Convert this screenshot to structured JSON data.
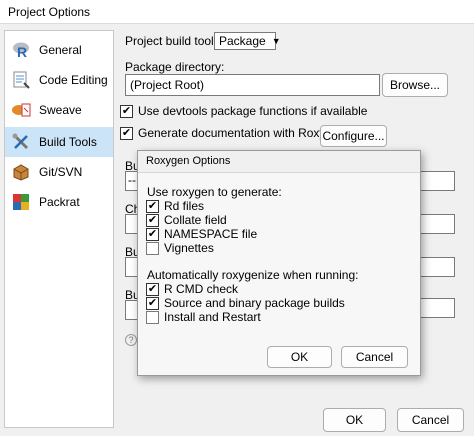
{
  "window": {
    "title": "Project Options"
  },
  "sidebar": {
    "items": [
      {
        "label": "General",
        "icon": "r-logo-icon"
      },
      {
        "label": "Code Editing",
        "icon": "code-editing-icon"
      },
      {
        "label": "Sweave",
        "icon": "sweave-icon"
      },
      {
        "label": "Build Tools",
        "icon": "build-tools-icon",
        "selected": true
      },
      {
        "label": "Git/SVN",
        "icon": "git-svn-icon"
      },
      {
        "label": "Packrat",
        "icon": "packrat-icon"
      }
    ]
  },
  "main": {
    "build_tools_label": "Project build tools:",
    "build_tools_value": "Package",
    "package_dir_label": "Package directory:",
    "package_dir_value": "(Project Root)",
    "browse_label": "Browse...",
    "devtools_label": "Use devtools package functions if available",
    "devtools_checked": true,
    "roxygen_label": "Generate documentation with Roxygen",
    "roxygen_checked": true,
    "configure_label": "Configure...",
    "partial_labels": [
      "Bu",
      "Ch",
      "Bu",
      "Bu"
    ],
    "partial_field_value": "--",
    "help_glyph": "?"
  },
  "roxygen_dialog": {
    "title": "Roxygen Options",
    "section1_label": "Use roxygen to generate:",
    "generate": [
      {
        "label": "Rd files",
        "checked": true
      },
      {
        "label": "Collate field",
        "checked": true
      },
      {
        "label": "NAMESPACE file",
        "checked": true
      },
      {
        "label": "Vignettes",
        "checked": false
      }
    ],
    "section2_label": "Automatically roxygenize when running:",
    "auto": [
      {
        "label": "R CMD check",
        "checked": true
      },
      {
        "label": "Source and binary package builds",
        "checked": true
      },
      {
        "label": "Install and Restart",
        "checked": false
      }
    ],
    "ok_label": "OK",
    "cancel_label": "Cancel"
  },
  "footer": {
    "ok_label": "OK",
    "cancel_label": "Cancel"
  },
  "colors": {
    "selected_bg": "#cce4f7",
    "r_blue": "#2a6bb5",
    "packrat_green": "#3a9a3a"
  }
}
